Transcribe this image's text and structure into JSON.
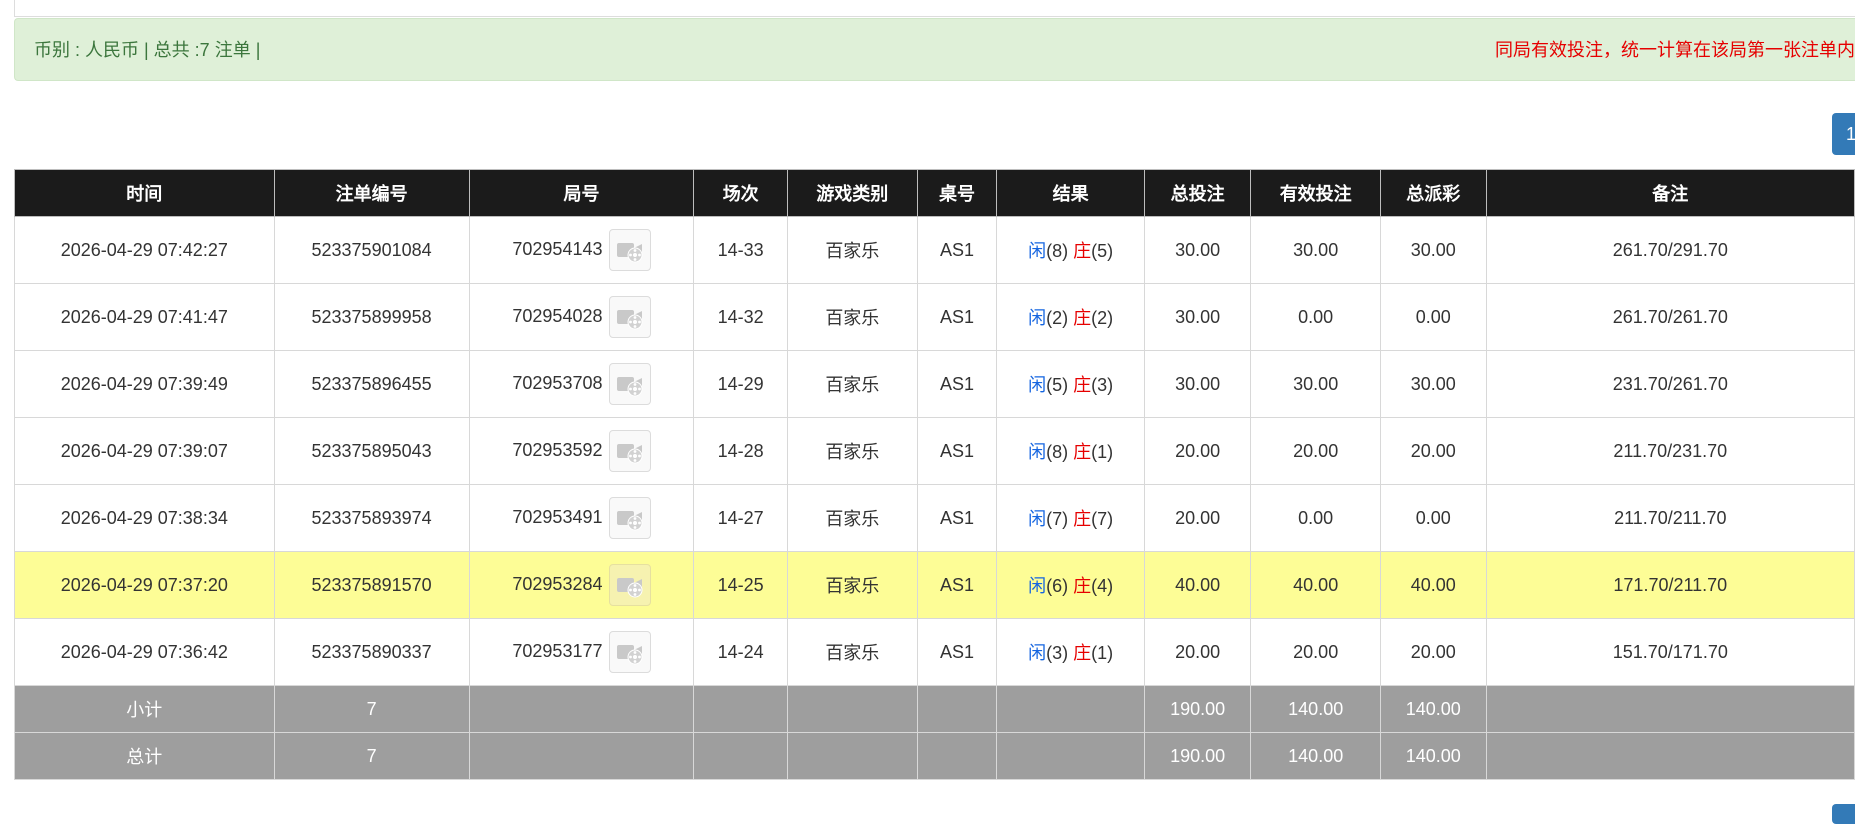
{
  "summary": {
    "left": "币别 : 人民币 | 总共 :7 注单 |",
    "notice": "同局有效投注，统一计算在该局第一张注单内"
  },
  "pagination": {
    "current": "1"
  },
  "table": {
    "headers": [
      "时间",
      "注单编号",
      "局号",
      "场次",
      "游戏类别",
      "桌号",
      "结果",
      "总投注",
      "有效投注",
      "总派彩",
      "备注"
    ],
    "rows": [
      {
        "time": "2026-04-29 07:42:27",
        "bet_id": "523375901084",
        "round_id": "702954143",
        "shoe": "14-33",
        "game": "百家乐",
        "table": "AS1",
        "player_label": "闲",
        "player_score": "(8)",
        "banker_label": "庄",
        "banker_score": "(5)",
        "total_bet": "30.00",
        "valid_bet": "30.00",
        "payout": "30.00",
        "remark": "261.70/291.70",
        "highlight": false
      },
      {
        "time": "2026-04-29 07:41:47",
        "bet_id": "523375899958",
        "round_id": "702954028",
        "shoe": "14-32",
        "game": "百家乐",
        "table": "AS1",
        "player_label": "闲",
        "player_score": "(2)",
        "banker_label": "庄",
        "banker_score": "(2)",
        "total_bet": "30.00",
        "valid_bet": "0.00",
        "payout": "0.00",
        "remark": "261.70/261.70",
        "highlight": false
      },
      {
        "time": "2026-04-29 07:39:49",
        "bet_id": "523375896455",
        "round_id": "702953708",
        "shoe": "14-29",
        "game": "百家乐",
        "table": "AS1",
        "player_label": "闲",
        "player_score": "(5)",
        "banker_label": "庄",
        "banker_score": "(3)",
        "total_bet": "30.00",
        "valid_bet": "30.00",
        "payout": "30.00",
        "remark": "231.70/261.70",
        "highlight": false
      },
      {
        "time": "2026-04-29 07:39:07",
        "bet_id": "523375895043",
        "round_id": "702953592",
        "shoe": "14-28",
        "game": "百家乐",
        "table": "AS1",
        "player_label": "闲",
        "player_score": "(8)",
        "banker_label": "庄",
        "banker_score": "(1)",
        "total_bet": "20.00",
        "valid_bet": "20.00",
        "payout": "20.00",
        "remark": "211.70/231.70",
        "highlight": false
      },
      {
        "time": "2026-04-29 07:38:34",
        "bet_id": "523375893974",
        "round_id": "702953491",
        "shoe": "14-27",
        "game": "百家乐",
        "table": "AS1",
        "player_label": "闲",
        "player_score": "(7)",
        "banker_label": "庄",
        "banker_score": "(7)",
        "total_bet": "20.00",
        "valid_bet": "0.00",
        "payout": "0.00",
        "remark": "211.70/211.70",
        "highlight": false
      },
      {
        "time": "2026-04-29 07:37:20",
        "bet_id": "523375891570",
        "round_id": "702953284",
        "shoe": "14-25",
        "game": "百家乐",
        "table": "AS1",
        "player_label": "闲",
        "player_score": "(6)",
        "banker_label": "庄",
        "banker_score": "(4)",
        "total_bet": "40.00",
        "valid_bet": "40.00",
        "payout": "40.00",
        "remark": "171.70/211.70",
        "highlight": true
      },
      {
        "time": "2026-04-29 07:36:42",
        "bet_id": "523375890337",
        "round_id": "702953177",
        "shoe": "14-24",
        "game": "百家乐",
        "table": "AS1",
        "player_label": "闲",
        "player_score": "(3)",
        "banker_label": "庄",
        "banker_score": "(1)",
        "total_bet": "20.00",
        "valid_bet": "20.00",
        "payout": "20.00",
        "remark": "151.70/171.70",
        "highlight": false
      }
    ],
    "subtotal": {
      "label": "小计",
      "count": "7",
      "total_bet": "190.00",
      "valid_bet": "140.00",
      "payout": "140.00"
    },
    "total": {
      "label": "总计",
      "count": "7",
      "total_bet": "190.00",
      "valid_bet": "140.00",
      "payout": "140.00"
    }
  },
  "icons": {
    "replay": "video-replay-icon"
  },
  "colors": {
    "header_bg": "#1b1b1b",
    "footer_bg": "#9e9e9e",
    "highlight_row": "#fdfd96",
    "player": "#1565e0",
    "banker": "#e60000",
    "notice_bg": "#dff0d8"
  }
}
